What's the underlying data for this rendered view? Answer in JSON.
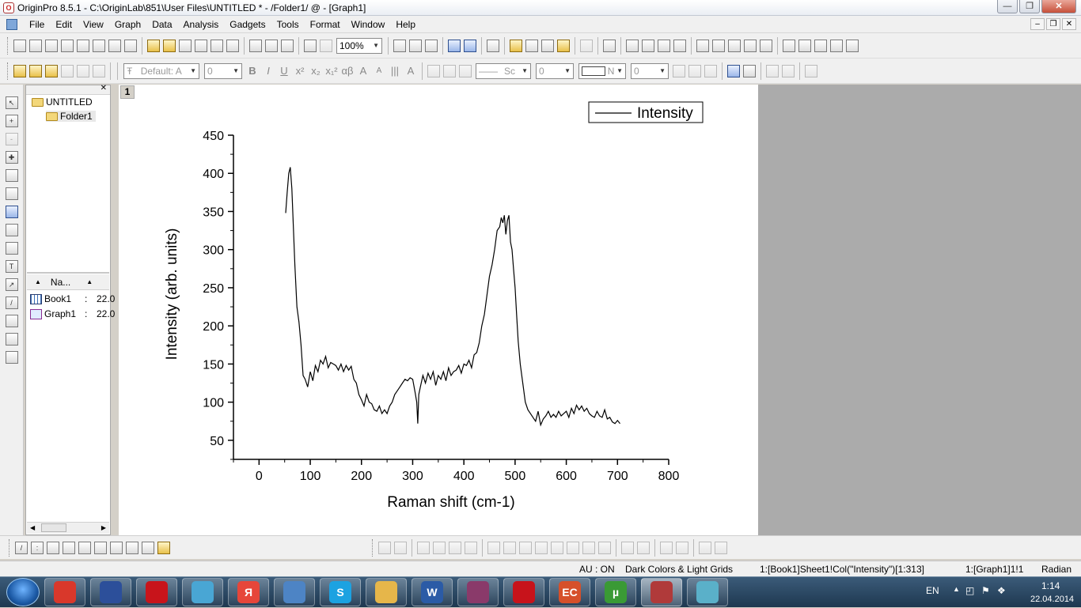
{
  "window": {
    "title": "OriginPro 8.5.1 - C:\\OriginLab\\851\\User Files\\UNTITLED * - /Folder1/ @ - [Graph1]",
    "controls": [
      "minimize-icon",
      "restore-icon",
      "close-icon"
    ]
  },
  "menu": {
    "items": [
      "File",
      "Edit",
      "View",
      "Graph",
      "Data",
      "Analysis",
      "Gadgets",
      "Tools",
      "Format",
      "Window",
      "Help"
    ]
  },
  "toolbar": {
    "zoom": "100%",
    "font_combo": "Default: A",
    "font_size": "0",
    "line_style": "Sc",
    "line_width": "0",
    "fill_combo": "N",
    "fill_value": "0",
    "format_buttons": [
      "B",
      "I",
      "U",
      "x²",
      "x₂",
      "x₁²",
      "αβ",
      "A",
      "A",
      "|||",
      "A"
    ]
  },
  "explorer": {
    "root": "UNTITLED",
    "folder": "Folder1",
    "column_header": "Na...",
    "items": [
      {
        "name": "Book1",
        "sep": ":",
        "date": "22.0",
        "type": "workbook-icon"
      },
      {
        "name": "Graph1",
        "sep": ":",
        "date": "22.0",
        "type": "graph-icon"
      }
    ]
  },
  "graph": {
    "page_number": "1",
    "legend": "Intensity"
  },
  "chart_data": {
    "type": "line",
    "xlabel": "Raman shift (cm-1)",
    "ylabel": "Intensity (arb. units)",
    "xlim": [
      -50,
      800
    ],
    "ylim": [
      25,
      450
    ],
    "xticks": [
      0,
      100,
      200,
      300,
      400,
      500,
      600,
      700,
      800
    ],
    "yticks": [
      50,
      100,
      150,
      200,
      250,
      300,
      350,
      400,
      450
    ],
    "legend": "top-right",
    "series": [
      {
        "name": "Intensity",
        "color": "#000000",
        "x": [
          52,
          55,
          58,
          61,
          64,
          67,
          70,
          74,
          78,
          82,
          86,
          90,
          95,
          100,
          105,
          110,
          115,
          120,
          125,
          130,
          135,
          140,
          145,
          150,
          155,
          160,
          165,
          170,
          175,
          180,
          185,
          190,
          195,
          200,
          205,
          210,
          215,
          220,
          225,
          230,
          235,
          240,
          245,
          250,
          255,
          260,
          265,
          270,
          275,
          280,
          285,
          290,
          295,
          300,
          305,
          308,
          310,
          312,
          315,
          320,
          325,
          330,
          335,
          340,
          345,
          350,
          355,
          360,
          365,
          370,
          375,
          380,
          385,
          390,
          395,
          400,
          405,
          410,
          415,
          420,
          425,
          430,
          435,
          440,
          445,
          450,
          455,
          460,
          465,
          470,
          473,
          476,
          479,
          482,
          485,
          488,
          491,
          494,
          497,
          500,
          503,
          506,
          510,
          515,
          520,
          525,
          530,
          535,
          540,
          545,
          550,
          555,
          560,
          565,
          570,
          575,
          580,
          585,
          590,
          595,
          600,
          605,
          610,
          615,
          620,
          625,
          630,
          635,
          640,
          645,
          650,
          655,
          660,
          665,
          670,
          675,
          680,
          685,
          690,
          695,
          700,
          705
        ],
        "y": [
          348,
          375,
          400,
          408,
          380,
          330,
          280,
          225,
          205,
          175,
          135,
          130,
          120,
          140,
          128,
          148,
          140,
          155,
          150,
          160,
          145,
          152,
          150,
          148,
          142,
          150,
          140,
          148,
          142,
          147,
          130,
          125,
          110,
          103,
          95,
          110,
          100,
          98,
          90,
          88,
          95,
          85,
          90,
          85,
          95,
          100,
          110,
          115,
          120,
          125,
          130,
          128,
          132,
          130,
          112,
          100,
          72,
          110,
          120,
          135,
          125,
          138,
          130,
          140,
          122,
          135,
          130,
          140,
          128,
          145,
          135,
          140,
          142,
          148,
          138,
          150,
          148,
          155,
          145,
          162,
          165,
          178,
          200,
          215,
          240,
          265,
          280,
          300,
          325,
          330,
          342,
          335,
          345,
          320,
          338,
          345,
          310,
          300,
          275,
          250,
          215,
          180,
          150,
          125,
          100,
          90,
          85,
          80,
          75,
          88,
          70,
          78,
          82,
          88,
          80,
          84,
          80,
          88,
          82,
          85,
          88,
          80,
          92,
          85,
          96,
          90,
          95,
          88,
          92,
          85,
          82,
          80,
          88,
          82,
          80,
          90,
          78,
          80,
          74,
          72,
          76,
          72
        ]
      }
    ]
  },
  "status": {
    "au": "AU : ON",
    "theme": "Dark Colors & Light Grids",
    "cell": "1:[Book1]Sheet1!Col(\"Intensity\")[1:313]",
    "layer": "1:[Graph1]1!1",
    "angle": "Radian"
  },
  "taskbar": {
    "language": "EN",
    "time": "1:14",
    "date": "22.04.2014",
    "apps": [
      {
        "name": "chrome",
        "glyph": "",
        "color": "#d9382b"
      },
      {
        "name": "floppy",
        "glyph": "",
        "color": "#2c4f9a"
      },
      {
        "name": "opera",
        "glyph": "",
        "color": "#c8141b"
      },
      {
        "name": "music",
        "glyph": "",
        "color": "#49a6d4"
      },
      {
        "name": "yandex",
        "glyph": "Я",
        "color": "#e6463a"
      },
      {
        "name": "volume",
        "glyph": "",
        "color": "#4d84c5"
      },
      {
        "name": "skype",
        "glyph": "S",
        "color": "#1ca2e1"
      },
      {
        "name": "explorer",
        "glyph": "",
        "color": "#e6b64a"
      },
      {
        "name": "word",
        "glyph": "W",
        "color": "#2b5ba6"
      },
      {
        "name": "winrar",
        "glyph": "",
        "color": "#8a3a6a"
      },
      {
        "name": "acrobat",
        "glyph": "",
        "color": "#c7131b"
      },
      {
        "name": "everest",
        "glyph": "EC",
        "color": "#d6502a"
      },
      {
        "name": "utorrent",
        "glyph": "µ",
        "color": "#3a9a35"
      },
      {
        "name": "origin",
        "glyph": "",
        "color": "#b03a3a"
      },
      {
        "name": "notes",
        "glyph": "",
        "color": "#5ab0c9"
      }
    ]
  }
}
